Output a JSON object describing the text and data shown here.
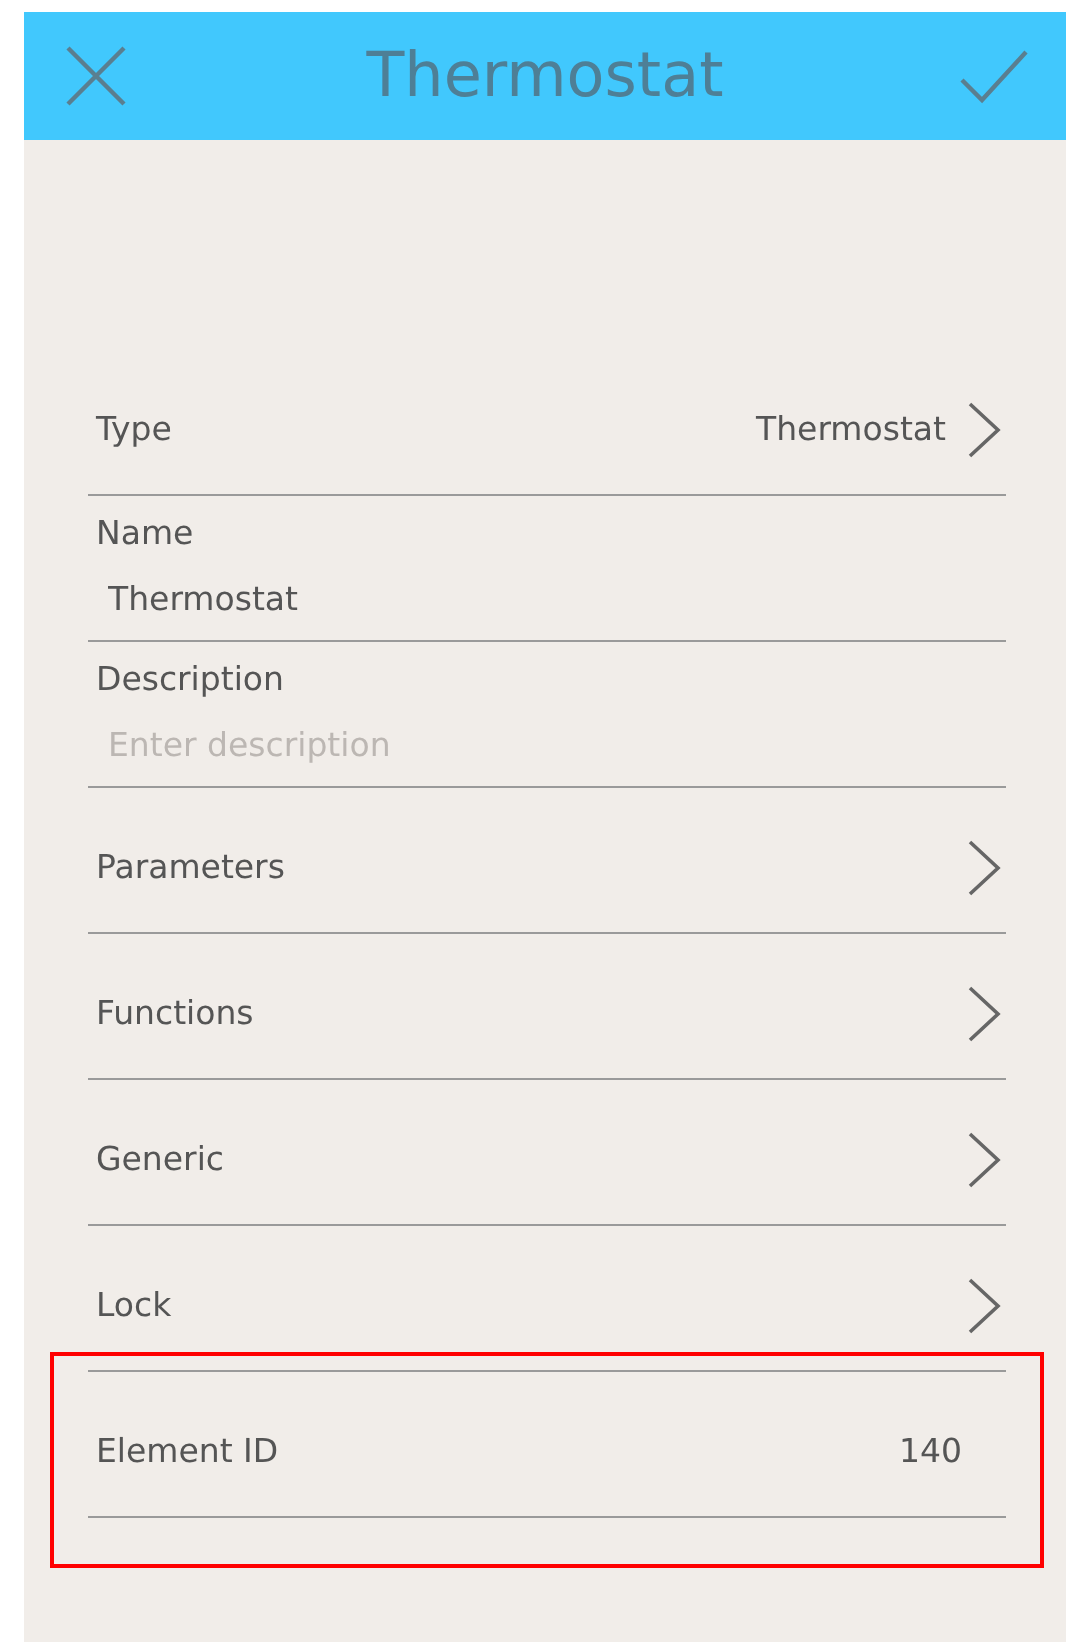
{
  "header": {
    "title": "Thermostat"
  },
  "rows": [
    {
      "kind": "nav",
      "label": "Type",
      "value": "Thermostat",
      "highlighted": false
    },
    {
      "kind": "field",
      "label": "Name",
      "value": "Thermostat",
      "highlighted": false
    },
    {
      "kind": "field",
      "label": "Description",
      "placeholder": "Enter description",
      "highlighted": false
    },
    {
      "kind": "nav",
      "label": "Parameters",
      "highlighted": false
    },
    {
      "kind": "nav",
      "label": "Functions",
      "highlighted": false
    },
    {
      "kind": "nav",
      "label": "Generic",
      "highlighted": false
    },
    {
      "kind": "nav",
      "label": "Lock",
      "highlighted": false
    },
    {
      "kind": "info",
      "label": "Element ID",
      "value": "140",
      "highlighted": true
    }
  ]
}
